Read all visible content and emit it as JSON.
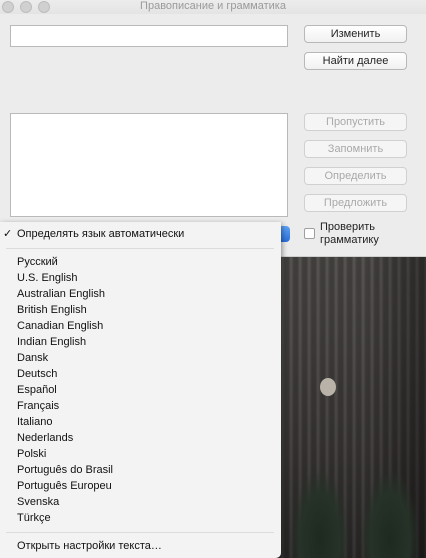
{
  "window": {
    "title": "Правописание и грамматика",
    "word_value": "",
    "buttons": {
      "change": "Изменить",
      "find_next": "Найти далее",
      "ignore": "Пропустить",
      "learn": "Запомнить",
      "define": "Определить",
      "guess": "Предложить"
    },
    "check_grammar_label": "Проверить грамматику",
    "check_grammar_checked": false
  },
  "menu": {
    "auto_detect": "Определять язык автоматически",
    "auto_detect_checked": true,
    "languages": [
      "Русский",
      "U.S. English",
      "Australian English",
      "British English",
      "Canadian English",
      "Indian English",
      "Dansk",
      "Deutsch",
      "Español",
      "Français",
      "Italiano",
      "Nederlands",
      "Polski",
      "Português do Brasil",
      "Português Europeu",
      "Svenska",
      "Türkçe"
    ],
    "open_settings": "Открыть настройки текста…"
  }
}
